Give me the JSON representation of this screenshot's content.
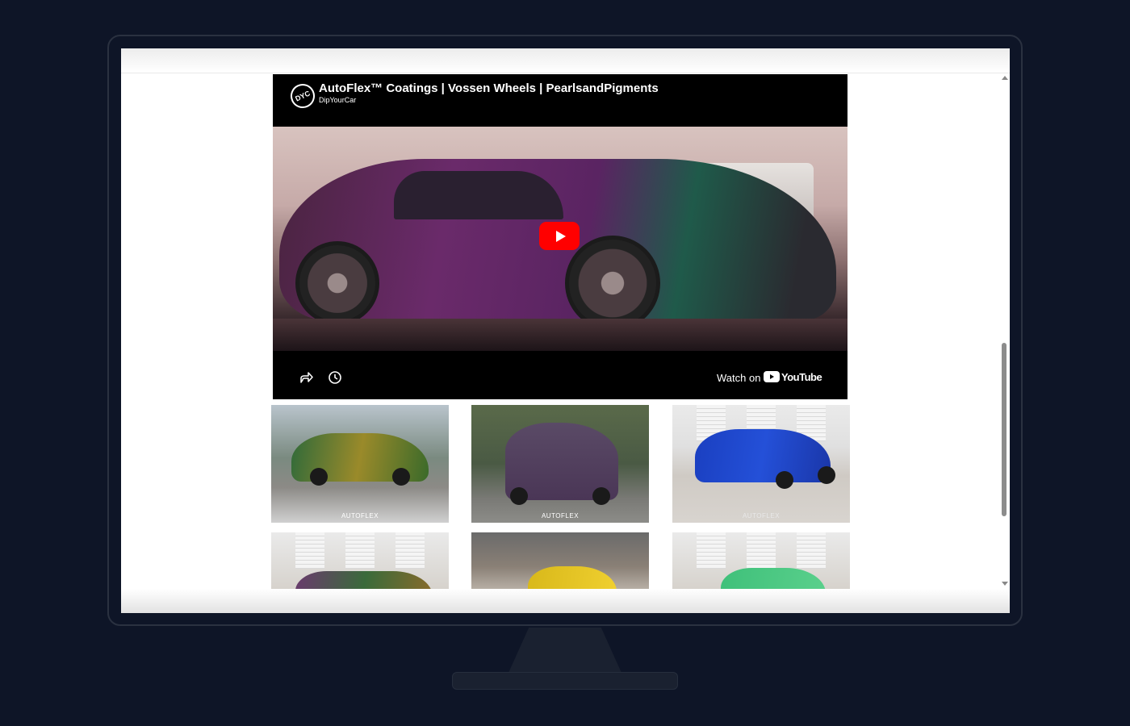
{
  "video": {
    "title": "AutoFlex™ Coatings | Vossen Wheels | PearlsandPigments",
    "channel": "DipYourCar",
    "channel_logo_text": "DYC",
    "watch_on_label": "Watch on",
    "platform_name": "YouTube"
  },
  "gallery": {
    "brand_label": "AUTOFLEX",
    "items": [
      {
        "color": "#2f6a3a"
      },
      {
        "color": "#4a3656"
      },
      {
        "color": "#1a3fc0"
      },
      {
        "color": "#6a3a6e"
      },
      {
        "color": "#d8b81a"
      },
      {
        "color": "#3fc07a"
      }
    ]
  },
  "colors": {
    "youtube_red": "#ff0000",
    "page_background": "#0e1527",
    "screen_background": "#ffffff"
  }
}
